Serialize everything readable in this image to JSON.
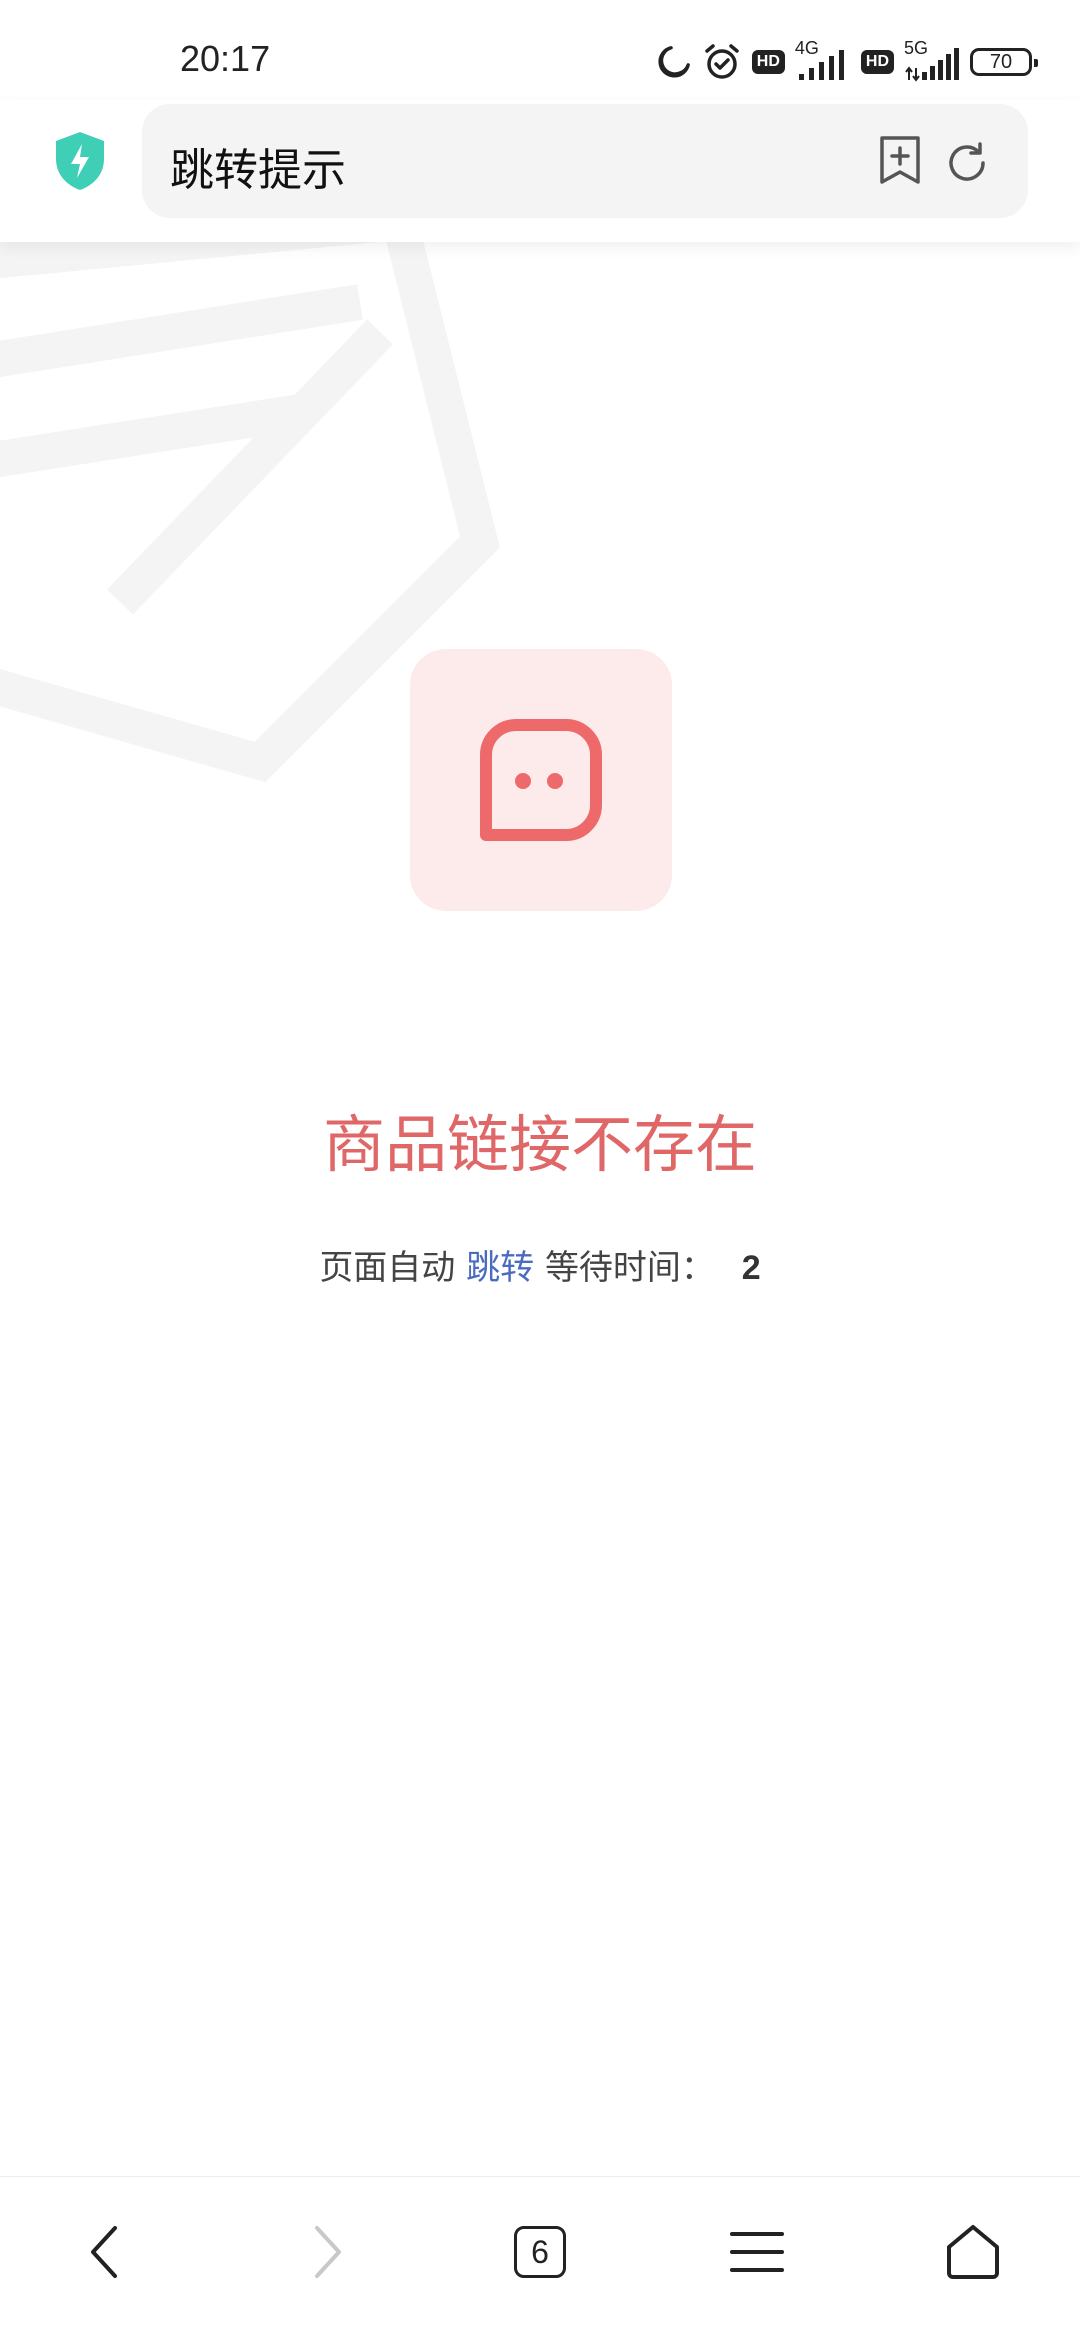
{
  "status_bar": {
    "time": "20:17",
    "icons": [
      "moon-icon",
      "alarm-icon",
      "hd-badge",
      "signal-4g-icon",
      "hd-badge",
      "signal-5g-icon",
      "battery-icon"
    ],
    "hd_label": "HD",
    "network_1": "4G",
    "network_2": "5G",
    "battery_level": "70"
  },
  "address_bar": {
    "title": "跳转提示",
    "shield_color": "#3ecfb6"
  },
  "content": {
    "message": "商品链接不存在",
    "redirect_prefix": "页面自动",
    "redirect_link": "跳转",
    "redirect_suffix": "等待时间：",
    "countdown": "2",
    "accent_color": "#e06767"
  },
  "bottom_nav": {
    "tab_count": "6",
    "icons": [
      "back-icon",
      "forward-icon",
      "tabs-icon",
      "menu-icon",
      "home-icon"
    ]
  }
}
